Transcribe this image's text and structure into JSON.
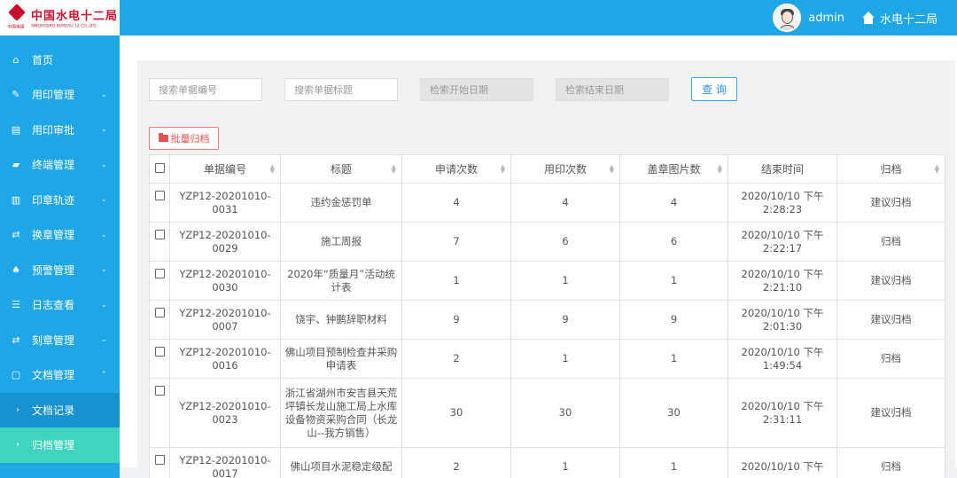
{
  "header": {
    "logo_cn": "中国水电十二局",
    "logo_en": "SINOHYDRO BUREAU 12 CO.,LTD.",
    "logo_cap": "中国电建",
    "username": "admin",
    "org": "水电十二局"
  },
  "sidebar": {
    "items": [
      {
        "label": "首页",
        "icon": "home-icon",
        "glyph": "⌂"
      },
      {
        "label": "用印管理",
        "icon": "edit-icon",
        "glyph": "✎"
      },
      {
        "label": "用印审批",
        "icon": "document-icon",
        "glyph": "▤"
      },
      {
        "label": "终端管理",
        "icon": "folder-icon",
        "glyph": "▰"
      },
      {
        "label": "印章轨迹",
        "icon": "map-icon",
        "glyph": "▥"
      },
      {
        "label": "换章管理",
        "icon": "swap-icon",
        "glyph": "⇄"
      },
      {
        "label": "预警管理",
        "icon": "bell-icon",
        "glyph": "♠"
      },
      {
        "label": "日志查看",
        "icon": "list-icon",
        "glyph": "☰"
      },
      {
        "label": "刻章管理",
        "icon": "swap-icon",
        "glyph": "⇄"
      },
      {
        "label": "文档管理",
        "icon": "doc-manage-icon",
        "glyph": "▢"
      }
    ],
    "sub_items": [
      {
        "label": "文档记录"
      },
      {
        "label": "归档管理"
      }
    ]
  },
  "search": {
    "doc_no_placeholder": "搜索单据编号",
    "title_placeholder": "搜索单据标题",
    "start_placeholder": "检索开始日期",
    "end_placeholder": "检索结束日期",
    "query_label": "查 询"
  },
  "batch_label": "批量归档",
  "table": {
    "headers": [
      "单据编号",
      "标题",
      "申请次数",
      "用印次数",
      "盖章图片数",
      "结束时间",
      "归档"
    ],
    "rows": [
      {
        "no": "YZP12-20201010-0031",
        "title": "违约金惩罚单",
        "apply": "4",
        "used": "4",
        "pics": "4",
        "end": "2020/10/10 下午 2:28:23",
        "archive": "建议归档",
        "status": "suggest"
      },
      {
        "no": "YZP12-20201010-0029",
        "title": "施工周报",
        "apply": "7",
        "used": "6",
        "pics": "6",
        "end": "2020/10/10 下午 2:22:17",
        "archive": "归档",
        "status": "archive"
      },
      {
        "no": "YZP12-20201010-0030",
        "title": "2020年“质量月”活动统计表",
        "apply": "1",
        "used": "1",
        "pics": "1",
        "end": "2020/10/10 下午 2:21:10",
        "archive": "建议归档",
        "status": "suggest"
      },
      {
        "no": "YZP12-20201010-0007",
        "title": "饶宇、钟鹏辞职材料",
        "apply": "9",
        "used": "9",
        "pics": "9",
        "end": "2020/10/10 下午 2:01:30",
        "archive": "建议归档",
        "status": "suggest"
      },
      {
        "no": "YZP12-20201010-0016",
        "title": "佛山项目预制检查井采购申请表",
        "apply": "2",
        "used": "1",
        "pics": "1",
        "end": "2020/10/10 下午 1:49:54",
        "archive": "归档",
        "status": "archive"
      },
      {
        "no": "YZP12-20201010-0023",
        "title": "浙江省湖州市安吉县天荒坪镇长龙山施工局上水库 设备物资采购合同（长龙山--我方销售）",
        "apply": "30",
        "used": "30",
        "pics": "30",
        "end": "2020/10/10 下午 2:31:11",
        "archive": "建议归档",
        "status": "suggest"
      },
      {
        "no": "YZP12-20201010-0017",
        "title": "佛山项目水泥稳定级配",
        "apply": "2",
        "used": "1",
        "pics": "1",
        "end": "2020/10/10 下午",
        "archive": "归档",
        "status": "archive"
      }
    ]
  },
  "colors": {
    "primary": "#1ea6e6",
    "active_sub": "#3ed4bd",
    "link": "#2e9fdd",
    "suggest": "#e82222"
  }
}
